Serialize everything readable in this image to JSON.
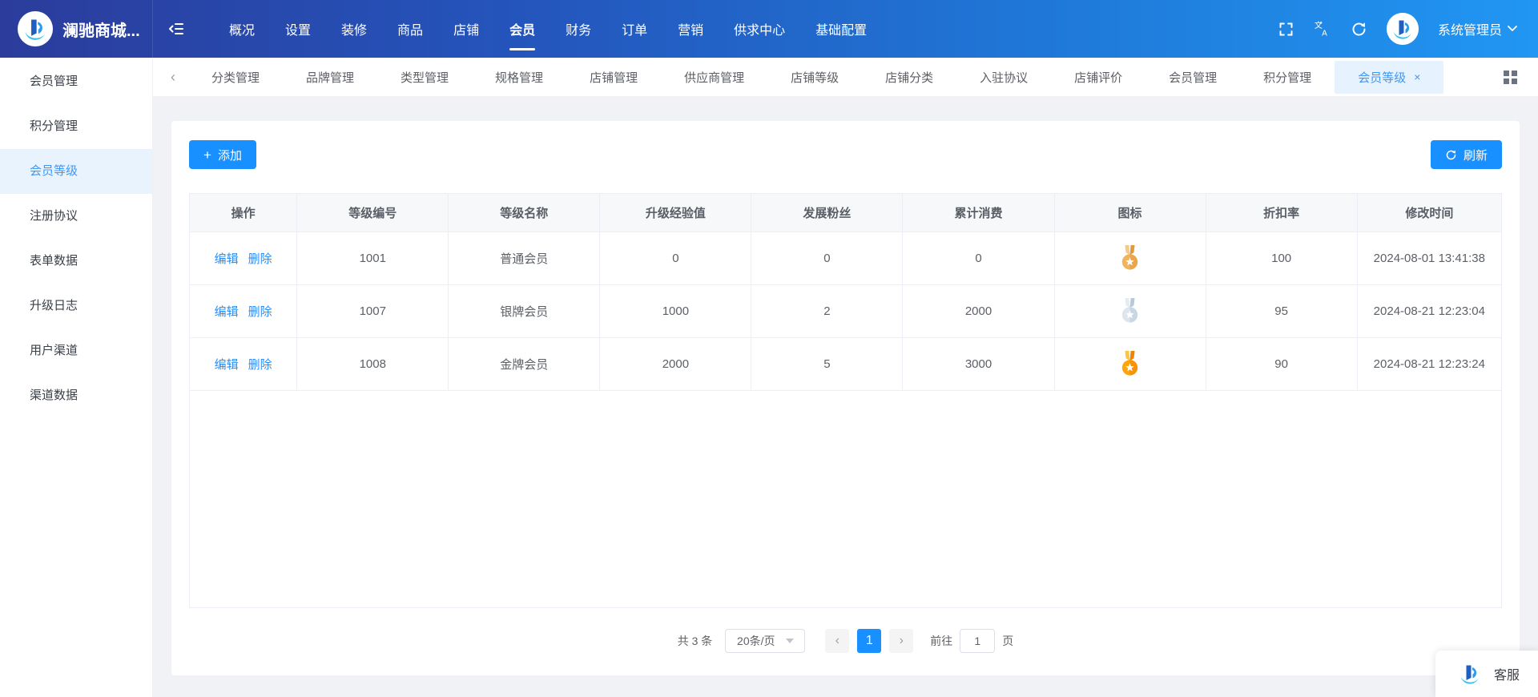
{
  "navbar": {
    "brand": "澜驰商城...",
    "menu_items": [
      "概况",
      "设置",
      "装修",
      "商品",
      "店铺",
      "会员",
      "财务",
      "订单",
      "营销",
      "供求中心",
      "基础配置"
    ],
    "active_item": "会员",
    "user_name": "系统管理员"
  },
  "tabbar": {
    "scroll_left_glyph": "‹",
    "tabs": [
      "分类管理",
      "品牌管理",
      "类型管理",
      "规格管理",
      "店铺管理",
      "供应商管理",
      "店铺等级",
      "店铺分类",
      "入驻协议",
      "店铺评价",
      "会员管理",
      "积分管理",
      "会员等级"
    ],
    "active_tab": "会员等级",
    "close_glyph": "×"
  },
  "sidebar": {
    "items": [
      "会员管理",
      "积分管理",
      "会员等级",
      "注册协议",
      "表单数据",
      "升级日志",
      "用户渠道",
      "渠道数据"
    ],
    "active_item": "会员等级"
  },
  "toolbar": {
    "add_icon": "+",
    "add_label": "添加",
    "refresh_label": "刷新"
  },
  "table": {
    "columns": [
      "操作",
      "等级编号",
      "等级名称",
      "升级经验值",
      "发展粉丝",
      "累计消费",
      "图标",
      "折扣率",
      "修改时间"
    ],
    "action_labels": {
      "edit": "编辑",
      "delete": "删除"
    },
    "rows": [
      {
        "level_no": "1001",
        "level_name": "普通会员",
        "upgrade_exp": "0",
        "fans": "0",
        "consume": "0",
        "icon": "bronze-medal-icon",
        "discount": "100",
        "modified_time": "2024-08-01 13:41:38"
      },
      {
        "level_no": "1007",
        "level_name": "银牌会员",
        "upgrade_exp": "1000",
        "fans": "2",
        "consume": "2000",
        "icon": "silver-medal-icon",
        "discount": "95",
        "modified_time": "2024-08-21 12:23:04"
      },
      {
        "level_no": "1008",
        "level_name": "金牌会员",
        "upgrade_exp": "2000",
        "fans": "5",
        "consume": "3000",
        "icon": "gold-medal-icon",
        "discount": "90",
        "modified_time": "2024-08-21 12:23:24"
      }
    ]
  },
  "medal_colors": {
    "bronze-medal-icon": {
      "body": "#f1b35e",
      "shade": "#e39a3b",
      "ribbon": "#f6c988",
      "star": "#ffffff"
    },
    "silver-medal-icon": {
      "body": "#dce6ef",
      "shade": "#b9c9d9",
      "ribbon": "#e3ebf3",
      "star": "#ffffff"
    },
    "gold-medal-icon": {
      "body": "#ffa60f",
      "shade": "#f08300",
      "ribbon": "#ffc53d",
      "star": "#ffffff"
    }
  },
  "pagination": {
    "total": "共 3 条",
    "page_size": "20条/页",
    "prev_glyph": "‹",
    "next_glyph": "›",
    "pages": [
      "1"
    ],
    "current_page": "1",
    "goto_label": "前往",
    "goto_value": "1",
    "goto_unit": "页"
  },
  "support": {
    "label": "客服"
  },
  "icons": {
    "navbar": [
      "logo-icon",
      "collapse-menu-icon",
      "fullscreen-icon",
      "language-icon",
      "refresh-icon",
      "avatar",
      "chevron-down-icon"
    ],
    "tabbar": [
      "tabs-scroll-left-icon",
      "tab-close-icon",
      "tab-grid-icon"
    ],
    "table": [
      "bronze-medal-icon",
      "silver-medal-icon",
      "gold-medal-icon"
    ],
    "misc": [
      "plus-icon",
      "refresh-button-icon",
      "select-chevron-icon",
      "customer-service-logo-icon"
    ]
  },
  "colors": {
    "primary": "#1890ff",
    "link": "#2d8cf0",
    "navbar_gradient_left": "#2b3c9c",
    "navbar_gradient_right": "#2196f3",
    "active_tab_bg": "#e6f2fd",
    "sidebar_active_bg": "#e8f3fe",
    "sidebar_active_text": "#3e97f5"
  }
}
